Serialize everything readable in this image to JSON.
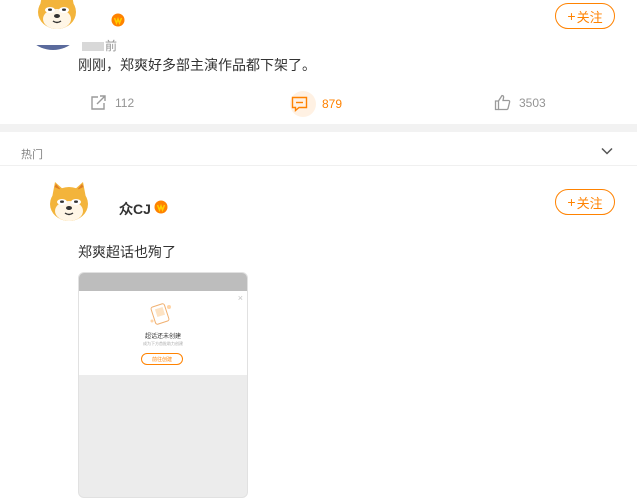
{
  "colors": {
    "accent": "#ff8200",
    "muted": "#939393",
    "text": "#333333",
    "divider": "#f2f2f2"
  },
  "post1": {
    "time": "前",
    "text": "刚刚，郑爽好多部主演作品都下架了。",
    "follow_label": "关注",
    "repost_count": "112",
    "comment_count": "879",
    "like_count": "3503",
    "icons": [
      "doge-avatar-icon",
      "vip-badge-icon",
      "repost-icon",
      "comment-icon",
      "like-icon"
    ]
  },
  "hot_section": {
    "title": "热门",
    "post": {
      "username": "众CJ",
      "follow_label": "关注",
      "text": "郑爽超话也殉了",
      "image": {
        "title": "超话还未创建",
        "subtitle": "成为下方首批助力创建",
        "button": "前往创建",
        "close": "×"
      }
    }
  }
}
